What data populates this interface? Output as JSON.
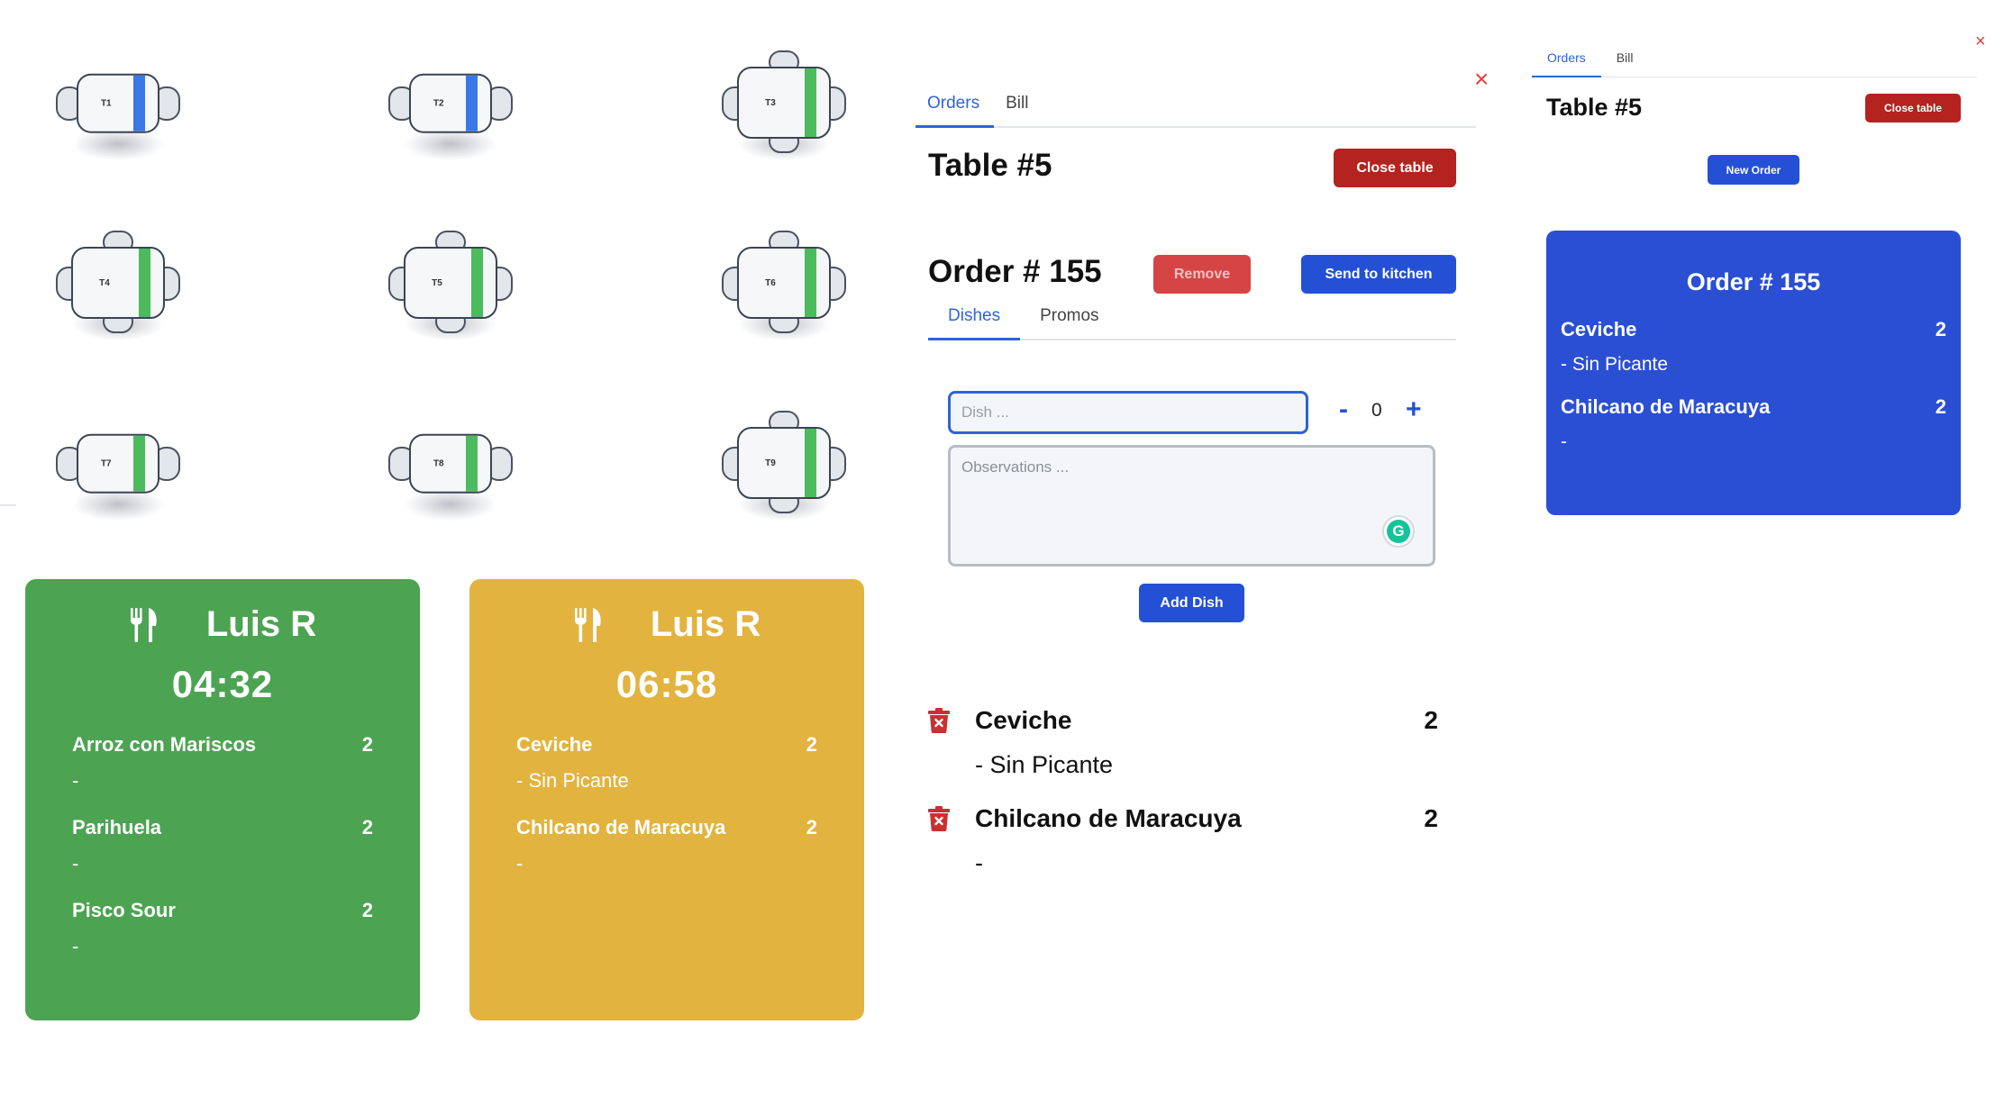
{
  "floor": {
    "tables": [
      {
        "label": "T1",
        "status_color": "#3b78e7",
        "size": "small"
      },
      {
        "label": "T2",
        "status_color": "#3b78e7",
        "size": "small"
      },
      {
        "label": "T3",
        "status_color": "#4cbb5d",
        "size": "large"
      },
      {
        "label": "T4",
        "status_color": "#4cbb5d",
        "size": "large"
      },
      {
        "label": "T5",
        "status_color": "#4cbb5d",
        "size": "large"
      },
      {
        "label": "T6",
        "status_color": "#4cbb5d",
        "size": "large"
      },
      {
        "label": "T7",
        "status_color": "#4cbb5d",
        "size": "small"
      },
      {
        "label": "T8",
        "status_color": "#4cbb5d",
        "size": "small"
      },
      {
        "label": "T9",
        "status_color": "#4cbb5d",
        "size": "large"
      }
    ]
  },
  "kitchen_cards": [
    {
      "color": "#4ca352",
      "waiter": "Luis R",
      "timer": "04:32",
      "items": [
        {
          "name": "Arroz con Mariscos",
          "qty": "2",
          "obs": "-"
        },
        {
          "name": "Parihuela",
          "qty": "2",
          "obs": "-"
        },
        {
          "name": "Pisco Sour",
          "qty": "2",
          "obs": "-"
        }
      ]
    },
    {
      "color": "#e2b33e",
      "waiter": "Luis R",
      "timer": "06:58",
      "items": [
        {
          "name": "Ceviche",
          "qty": "2",
          "obs": "- Sin Picante"
        },
        {
          "name": "Chilcano de Maracuya",
          "qty": "2",
          "obs": "-"
        }
      ]
    }
  ],
  "table_panel": {
    "close_symbol": "×",
    "tabs": [
      "Orders",
      "Bill"
    ],
    "title": "Table #5",
    "close_table_label": "Close table",
    "order": {
      "title": "Order # 155",
      "remove_label": "Remove",
      "send_label": "Send to kitchen",
      "subtabs": [
        "Dishes",
        "Promos"
      ],
      "dish_placeholder": "Dish ...",
      "qty_minus": "-",
      "qty_value": "0",
      "qty_plus": "+",
      "observations_placeholder": "Observations ...",
      "add_dish_label": "Add Dish",
      "items": [
        {
          "name": "Ceviche",
          "qty": "2",
          "obs": "- Sin Picante"
        },
        {
          "name": "Chilcano de Maracuya",
          "qty": "2",
          "obs": "-"
        }
      ]
    }
  },
  "mini_panel": {
    "close_symbol": "×",
    "tabs": [
      "Orders",
      "Bill"
    ],
    "title": "Table #5",
    "close_table_label": "Close table",
    "new_order_label": "New Order",
    "card": {
      "color": "#2a4fd3",
      "title": "Order # 155",
      "items": [
        {
          "name": "Ceviche",
          "qty": "2",
          "obs": "- Sin Picante"
        },
        {
          "name": "Chilcano de Maracuya",
          "qty": "2",
          "obs": "-"
        }
      ]
    }
  },
  "colors": {
    "accent": "#2f63d8",
    "danger": "#b4231f",
    "primary_button": "#2450d6"
  }
}
